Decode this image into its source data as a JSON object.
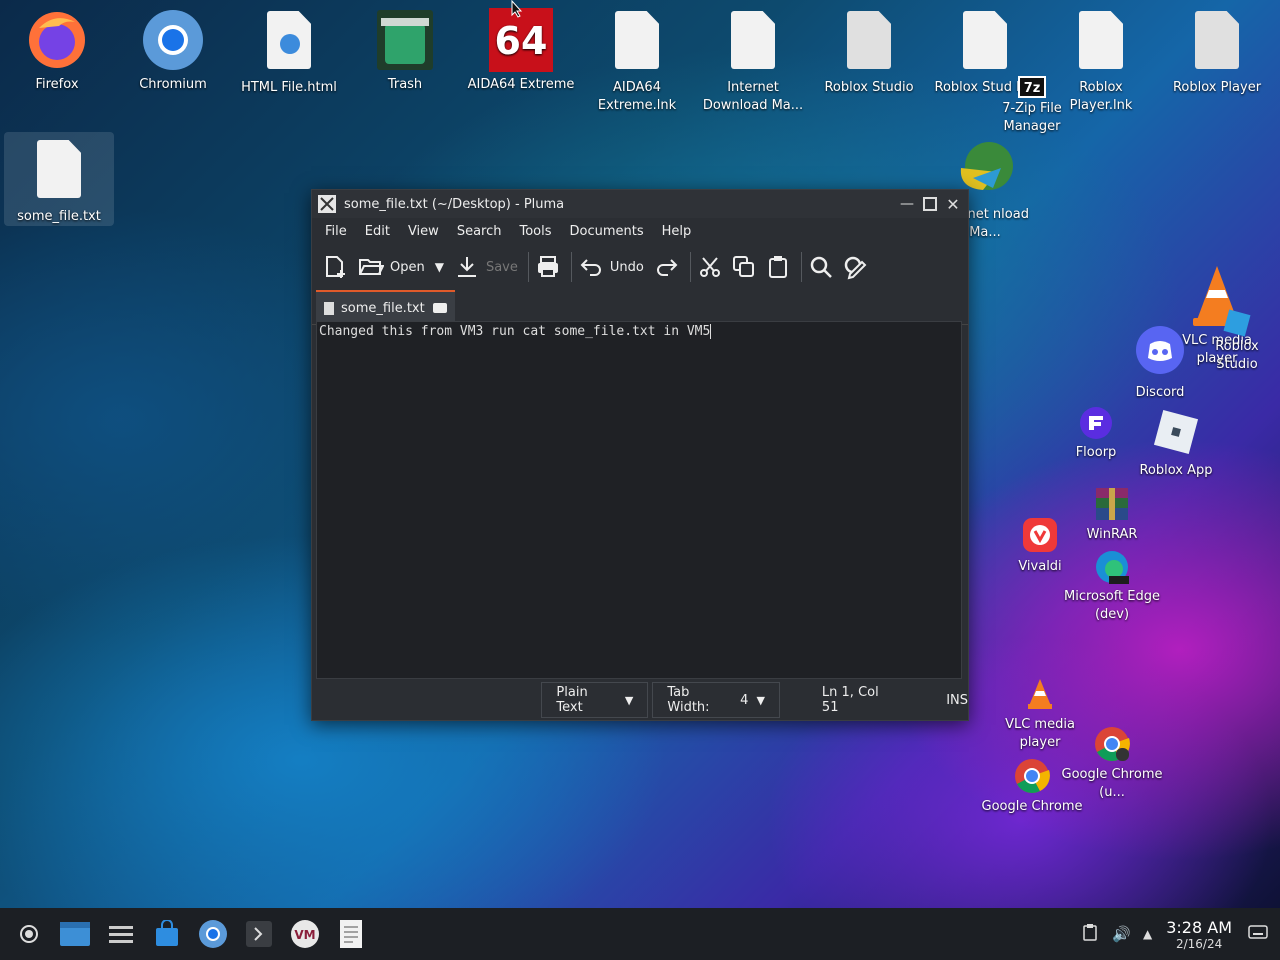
{
  "desktop": {
    "icons": [
      {
        "label": "Firefox"
      },
      {
        "label": "Chromium"
      },
      {
        "label": "HTML File.html"
      },
      {
        "label": "Trash"
      },
      {
        "label": "AIDA64 Extreme"
      },
      {
        "label": "AIDA64 Extreme.lnk"
      },
      {
        "label": "Internet Download Ma..."
      },
      {
        "label": "Roblox Studio"
      },
      {
        "label": "Roblox Stud lnk"
      },
      {
        "label": "Roblox Player.lnk"
      },
      {
        "label": "Roblox Player"
      },
      {
        "label": "7-Zip File Manager"
      },
      {
        "label": "some_file.txt"
      },
      {
        "label": "nternet nload Ma..."
      },
      {
        "label": "VLC media player"
      },
      {
        "label": "Roblox Studio"
      },
      {
        "label": "Discord"
      },
      {
        "label": "Floorp"
      },
      {
        "label": "Roblox App"
      },
      {
        "label": "WinRAR"
      },
      {
        "label": "Vivaldi"
      },
      {
        "label": "Microsoft Edge (dev)"
      },
      {
        "label": "VLC media player"
      },
      {
        "label": "Google Chrome"
      },
      {
        "label": "Google Chrome (u..."
      }
    ]
  },
  "window": {
    "title": "some_file.txt (~/Desktop) - Pluma",
    "menu": [
      "File",
      "Edit",
      "View",
      "Search",
      "Tools",
      "Documents",
      "Help"
    ],
    "toolbar": {
      "open_label": "Open",
      "save_label": "Save",
      "undo_label": "Undo"
    },
    "tab_label": "some_file.txt",
    "content": "Changed this from VM3 run cat some_file.txt in VM5",
    "status": {
      "language": "Plain Text",
      "tab_width_label": "Tab Width:",
      "tab_width_value": "4",
      "position": "Ln 1, Col 51",
      "mode": "INS"
    }
  },
  "taskbar": {
    "time": "3:28 AM",
    "date": "2/16/24"
  },
  "colors": {
    "accent": "#e05a2a",
    "editor_bg": "#1f2125",
    "taskbar_bg": "#1c1f24"
  }
}
